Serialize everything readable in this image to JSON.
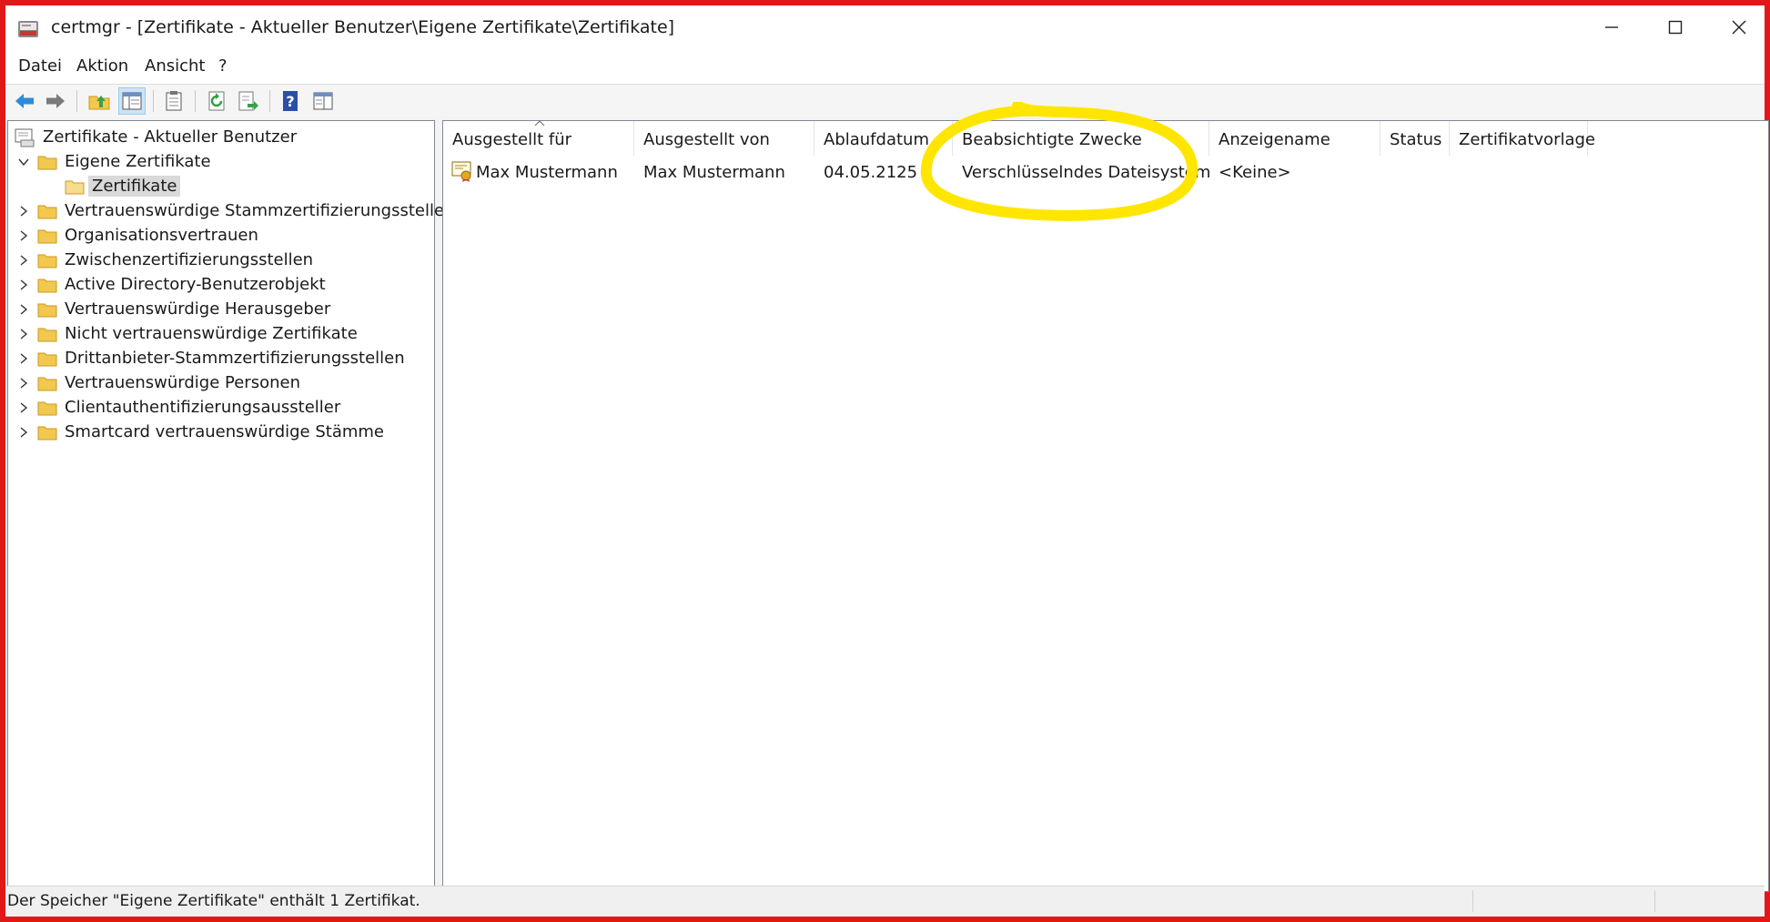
{
  "window": {
    "title": "certmgr - [Zertifikate - Aktueller Benutzer\\Eigene Zertifikate\\Zertifikate]",
    "minimize_icon": "minimize-icon",
    "maximize_icon": "maximize-icon",
    "close_icon": "close-icon"
  },
  "menu": {
    "items": [
      "Datei",
      "Aktion",
      "Ansicht",
      "?"
    ]
  },
  "toolbar": {
    "buttons": [
      "back-icon",
      "forward-icon",
      "up-folder-icon",
      "show-hide-tree-icon",
      "clipboard-icon",
      "refresh-icon",
      "export-list-icon",
      "help-icon",
      "properties-icon"
    ]
  },
  "tree": {
    "root": "Zertifikate - Aktueller Benutzer",
    "items": [
      {
        "label": "Eigene Zertifikate",
        "expanded": true
      },
      {
        "label": "Zertifikate",
        "selected": true
      },
      {
        "label": "Vertrauenswürdige Stammzertifizierungsstellen"
      },
      {
        "label": "Organisationsvertrauen"
      },
      {
        "label": "Zwischenzertifizierungsstellen"
      },
      {
        "label": "Active Directory-Benutzerobjekt"
      },
      {
        "label": "Vertrauenswürdige Herausgeber"
      },
      {
        "label": "Nicht vertrauenswürdige Zertifikate"
      },
      {
        "label": "Drittanbieter-Stammzertifizierungsstellen"
      },
      {
        "label": "Vertrauenswürdige Personen"
      },
      {
        "label": "Clientauthentifizierungsaussteller"
      },
      {
        "label": "Smartcard vertrauenswürdige Stämme"
      }
    ]
  },
  "list": {
    "columns": [
      "Ausgestellt für",
      "Ausgestellt von",
      "Ablaufdatum",
      "Beabsichtigte Zwecke",
      "Anzeigename",
      "Status",
      "Zertifikatvorlage"
    ],
    "rows": [
      {
        "issued_to": "Max Mustermann",
        "issued_by": "Max Mustermann",
        "expires": "04.05.2125",
        "purposes": "Verschlüsselndes Dateisystem",
        "friendly_name": "<Keine>",
        "status": "",
        "template": ""
      }
    ]
  },
  "status": {
    "text": "Der Speicher \"Eigene Zertifikate\" enthält 1 Zertifikat."
  },
  "colors": {
    "frame_border": "#e01818",
    "highlight_marker": "#ffe600",
    "folder": "#f3c84f",
    "toolbar_arrow": "#2c8bd8"
  }
}
